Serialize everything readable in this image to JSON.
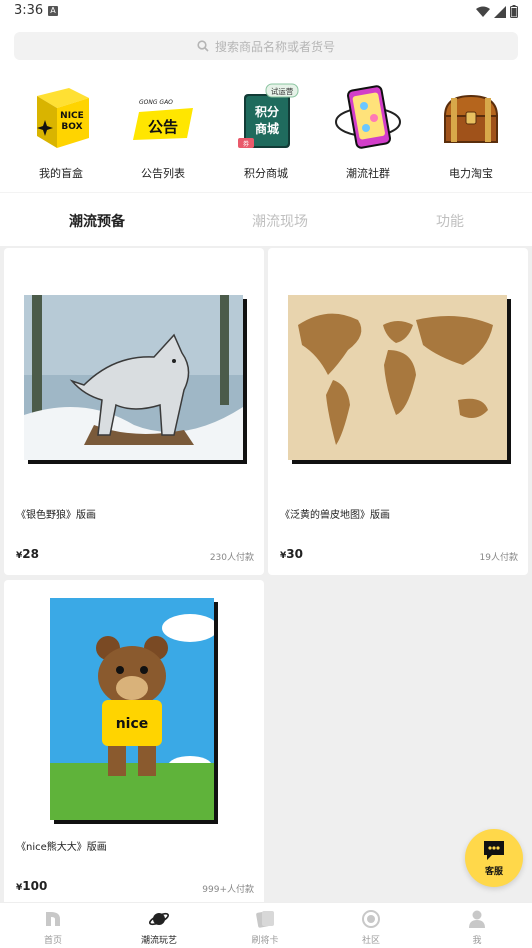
{
  "status_bar": {
    "time": "3:36",
    "a_badge": "A"
  },
  "search": {
    "placeholder": "搜索商品名称或者货号"
  },
  "categories": [
    {
      "label": "我的盲盒",
      "icon": "nice-box-icon",
      "art_text_1": "NICE",
      "art_text_2": "BOX"
    },
    {
      "label": "公告列表",
      "icon": "announcement-icon",
      "art_small": "GONG GAO",
      "art_text": "公告"
    },
    {
      "label": "积分商城",
      "icon": "points-mall-icon",
      "art_badge": "试运营",
      "art_text_1": "积分",
      "art_text_2": "商城",
      "art_tag": "券"
    },
    {
      "label": "潮流社群",
      "icon": "community-phone-icon"
    },
    {
      "label": "电力淘宝",
      "icon": "treasure-chest-icon"
    }
  ],
  "tabs": [
    {
      "label": "潮流预备",
      "active": true
    },
    {
      "label": "潮流现场",
      "active": false
    },
    {
      "label": "功能",
      "active": false
    }
  ],
  "products": [
    {
      "title": "《银色野狼》版画",
      "currency": "¥",
      "price": "28",
      "paid": "230人付款",
      "image": "silver-wolf-art"
    },
    {
      "title": "《泛黄的兽皮地图》版画",
      "currency": "¥",
      "price": "30",
      "paid": "19人付款",
      "image": "world-map-art"
    },
    {
      "title": "《nice熊大大》版画",
      "currency": "¥",
      "price": "100",
      "paid": "999+人付款",
      "image": "nice-bear-art",
      "art_text": "nice"
    }
  ],
  "fab": {
    "label": "客服",
    "icon": "chat-bubble-icon"
  },
  "nav": [
    {
      "label": "首页",
      "icon": "home-icon",
      "active": false
    },
    {
      "label": "潮流玩艺",
      "icon": "planet-icon",
      "active": true
    },
    {
      "label": "刷将卡",
      "icon": "cards-icon",
      "active": false
    },
    {
      "label": "社区",
      "icon": "circle-target-icon",
      "active": false
    },
    {
      "label": "我",
      "icon": "profile-icon",
      "active": false
    }
  ],
  "colors": {
    "accent_yellow": "#ffd84a",
    "background": "#efefef",
    "inactive_text": "#c0c0c0"
  }
}
